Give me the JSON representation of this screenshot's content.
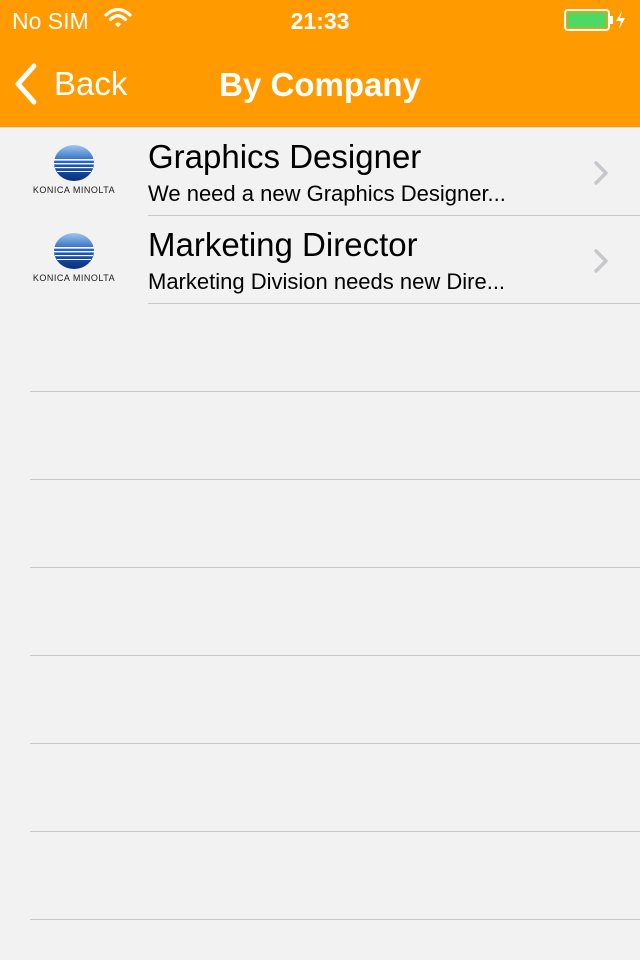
{
  "status_bar": {
    "carrier": "No SIM",
    "time": "21:33",
    "wifi_icon": "wifi-icon",
    "battery_icon": "battery-charging-icon"
  },
  "nav": {
    "back_label": "Back",
    "title": "By Company"
  },
  "colors": {
    "header": "#ff9a00",
    "background": "#f2f2f2",
    "battery": "#4cd964"
  },
  "jobs": [
    {
      "company_logo_text": "KONICA MINOLTA",
      "title": "Graphics Designer",
      "subtitle": "We need a new Graphics Designer..."
    },
    {
      "company_logo_text": "KONICA MINOLTA",
      "title": "Marketing Director",
      "subtitle": "Marketing Division needs new Dire..."
    }
  ]
}
